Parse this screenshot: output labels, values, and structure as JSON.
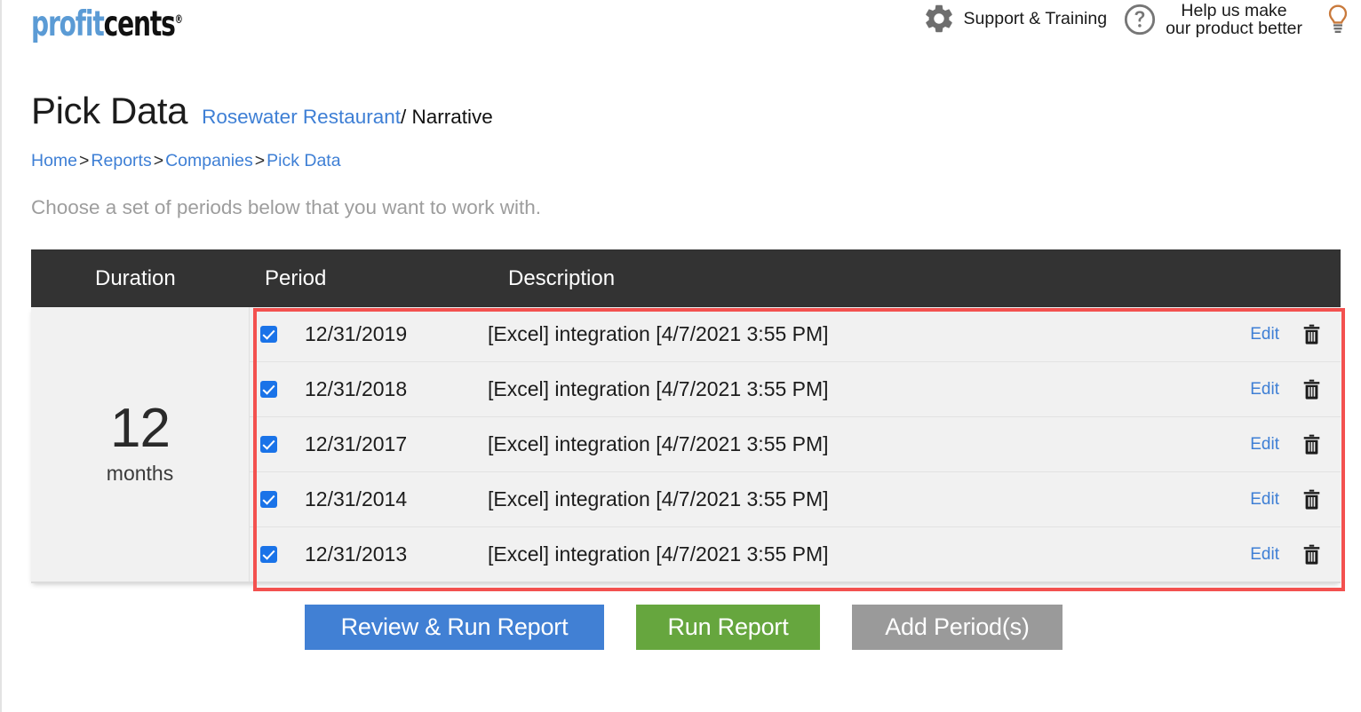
{
  "header": {
    "logo": {
      "part1": "profit",
      "part2": "cents",
      "registered": "®"
    },
    "support_label": "Support & Training",
    "feedback_line1": "Help us make",
    "feedback_line2": "our product better",
    "icons": {
      "gear": "gear-icon",
      "help": "question-circle-icon",
      "bulb": "lightbulb-icon"
    }
  },
  "title": {
    "page_title": "Pick Data",
    "company": "Rosewater Restaurant",
    "separator": "/",
    "report_type": "Narrative"
  },
  "breadcrumb": {
    "items": [
      "Home",
      "Reports",
      "Companies",
      "Pick Data"
    ],
    "separator": ">"
  },
  "instruction": "Choose a set of periods below that you want to work with.",
  "table": {
    "columns": [
      "Duration",
      "Period",
      "Description"
    ],
    "duration": {
      "number": "12",
      "unit": "months"
    },
    "rows": [
      {
        "checked": true,
        "date": "12/31/2019",
        "description": "[Excel] integration [4/7/2021 3:55 PM]",
        "edit": "Edit",
        "delete": "delete-icon"
      },
      {
        "checked": true,
        "date": "12/31/2018",
        "description": "[Excel] integration [4/7/2021 3:55 PM]",
        "edit": "Edit",
        "delete": "delete-icon"
      },
      {
        "checked": true,
        "date": "12/31/2017",
        "description": "[Excel] integration [4/7/2021 3:55 PM]",
        "edit": "Edit",
        "delete": "delete-icon"
      },
      {
        "checked": true,
        "date": "12/31/2014",
        "description": "[Excel] integration [4/7/2021 3:55 PM]",
        "edit": "Edit",
        "delete": "delete-icon"
      },
      {
        "checked": true,
        "date": "12/31/2013",
        "description": "[Excel] integration [4/7/2021 3:55 PM]",
        "edit": "Edit",
        "delete": "delete-icon"
      }
    ]
  },
  "buttons": {
    "review_run": "Review & Run Report",
    "run": "Run Report",
    "add_period": "Add Period(s)"
  },
  "colors": {
    "link_blue": "#3e7fd5",
    "logo_blue": "#5b9bd5",
    "header_dark": "#333333",
    "checkbox_blue": "#1a73e8",
    "highlight_red": "#f3514f",
    "btn_blue": "#4180d4",
    "btn_green": "#66a63e",
    "btn_gray": "#9a9a9a",
    "row_bg": "#f1f1f1",
    "instruction_gray": "#9d9d9d"
  }
}
